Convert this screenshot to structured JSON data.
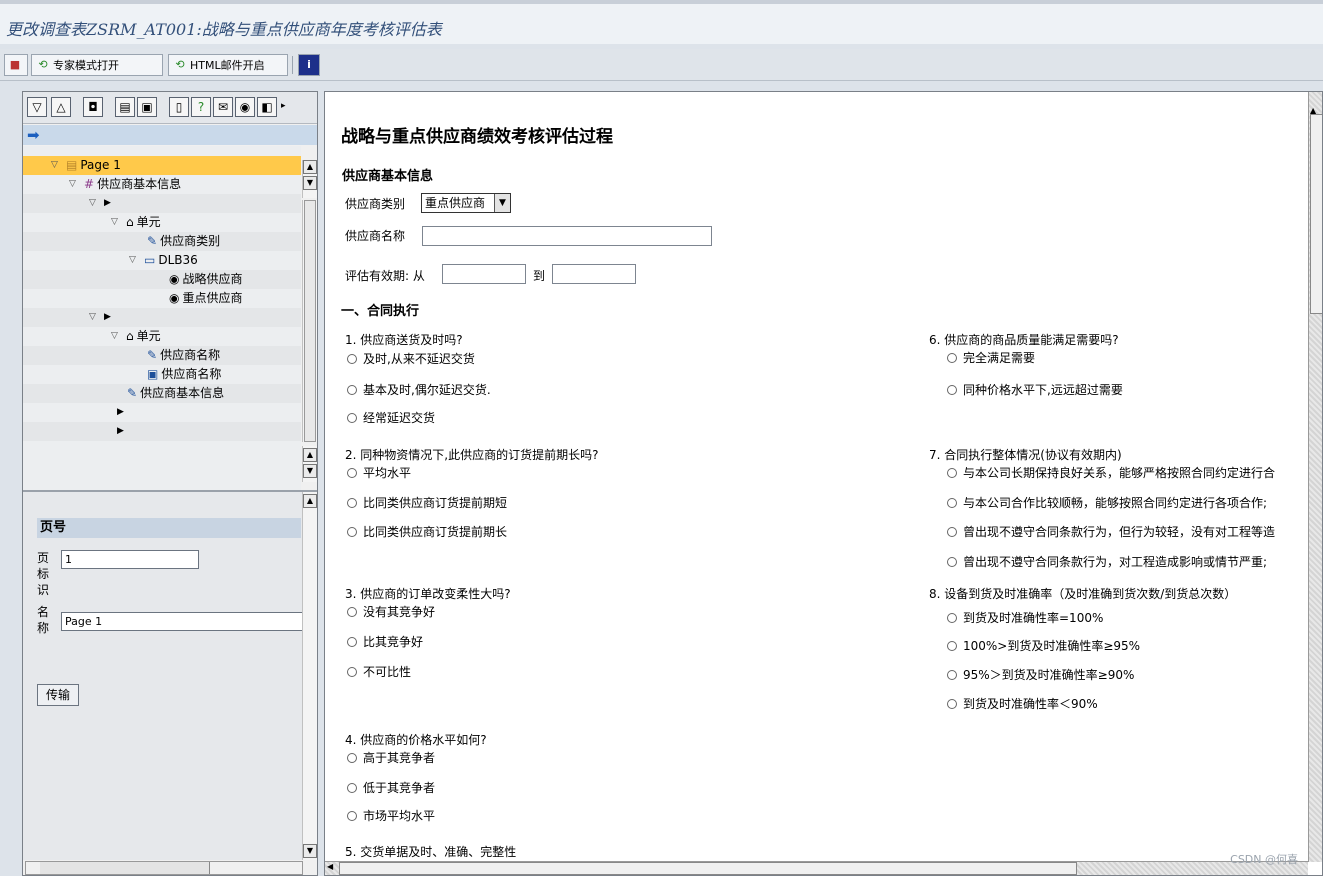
{
  "window": {
    "title": "更改调查表ZSRM_AT001:战略与重点供应商年度考核评估表"
  },
  "toolbar": {
    "expert_mode_label": "专家模式打开",
    "html_mail_label": "HTML邮件开启"
  },
  "tree": {
    "items": [
      {
        "label": "Page 1"
      },
      {
        "label": "供应商基本信息"
      },
      {
        "label": ""
      },
      {
        "label": "单元"
      },
      {
        "label": "供应商类别"
      },
      {
        "label": "DLB36"
      },
      {
        "label": "战略供应商"
      },
      {
        "label": "重点供应商"
      },
      {
        "label": ""
      },
      {
        "label": "单元"
      },
      {
        "label": "供应商名称"
      },
      {
        "label": "供应商名称"
      },
      {
        "label": "供应商基本信息"
      }
    ]
  },
  "properties": {
    "header": "页号",
    "page_id_label_1": "页",
    "page_id_label_2": "标",
    "page_id_label_3": "识",
    "page_id_value": "1",
    "name_label_1": "名",
    "name_label_2": "称",
    "name_value": "Page 1",
    "transfer_button": "传输"
  },
  "form": {
    "title": "战略与重点供应商绩效考核评估过程",
    "section_basic": "供应商基本信息",
    "category_label": "供应商类别",
    "category_value": "重点供应商",
    "name_label": "供应商名称",
    "validity_label": "评估有效期: 从",
    "validity_to": "到",
    "section_contract": "一、合同执行",
    "questions": [
      {
        "text": "1. 供应商送货及时吗?",
        "options": [
          "及时,从来不延迟交货",
          "基本及时,偶尔延迟交货.",
          "经常延迟交货"
        ]
      },
      {
        "text": "2. 同种物资情况下,此供应商的订货提前期长吗?",
        "options": [
          "平均水平",
          "比同类供应商订货提前期短",
          "比同类供应商订货提前期长"
        ]
      },
      {
        "text": "3. 供应商的订单改变柔性大吗?",
        "options": [
          "没有其竞争好",
          "比其竞争好",
          "不可比性"
        ]
      },
      {
        "text": "4. 供应商的价格水平如何?",
        "options": [
          "高于其竞争者",
          "低于其竞争者",
          "市场平均水平"
        ]
      },
      {
        "text": "5. 交货单据及时、准确、完整性",
        "options": []
      },
      {
        "text": "6. 供应商的商品质量能满足需要吗?",
        "options": [
          "完全满足需要",
          "同种价格水平下,远远超过需要"
        ]
      },
      {
        "text": "7. 合同执行整体情况(协议有效期内)",
        "options": [
          "与本公司长期保持良好关系，能够严格按照合同约定进行合",
          "与本公司合作比较顺畅，能够按照合同约定进行各项合作;",
          "曾出现不遵守合同条款行为，但行为较轻，没有对工程等造",
          "曾出现不遵守合同条款行为，对工程造成影响或情节严重;"
        ]
      },
      {
        "text": "8. 设备到货及时准确率（及时准确到货次数/到货总次数）",
        "options": [
          "到货及时准确性率=100%",
          "100%>到货及时准确性率≥95%",
          "95%＞到货及时准确性率≥90%",
          "到货及时准确性率＜90%"
        ]
      }
    ]
  },
  "watermark": "CSDN @何喜"
}
